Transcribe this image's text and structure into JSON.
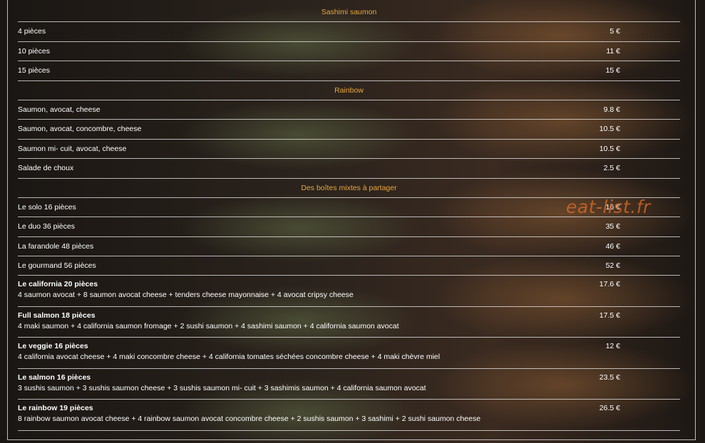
{
  "sections": [
    {
      "title": "Sashimi saumon",
      "items": [
        {
          "name": "4 pièces",
          "price": "5 €"
        },
        {
          "name": "10 pièces",
          "price": "11 €"
        },
        {
          "name": "15 pièces",
          "price": "15 €"
        }
      ]
    },
    {
      "title": "Rainbow",
      "items": [
        {
          "name": "Saumon, avocat, cheese",
          "price": "9.8 €"
        },
        {
          "name": "Saumon, avocat, concombre, cheese",
          "price": "10.5 €"
        },
        {
          "name": "Saumon mi- cuit, avocat, cheese",
          "price": "10.5 €"
        },
        {
          "name": "Salade de choux",
          "price": "2.5 €"
        }
      ]
    },
    {
      "title": "Des boîtes mixtes à partager",
      "items": [
        {
          "name": "Le solo 16 pièces",
          "price": "16 €"
        },
        {
          "name": "Le duo 36 pièces",
          "price": "35 €"
        },
        {
          "name": "La farandole 48 pièces",
          "price": "46 €"
        },
        {
          "name": "Le gourmand 56 pièces",
          "price": "52 €"
        }
      ],
      "combos": [
        {
          "name": "Le california 20 pièces",
          "price": "17.6 €",
          "description": "4 saumon avocat + 8 saumon avocat cheese + tenders cheese mayonnaise + 4 avocat cripsy cheese"
        },
        {
          "name": "Full salmon 18 pièces",
          "price": "17.5 €",
          "description": "4 maki saumon + 4 california saumon fromage + 2 sushi saumon + 4 sashimi saumon + 4 california saumon avocat"
        },
        {
          "name": "Le veggie 16 pièces",
          "price": "12 €",
          "description": "4 california avocat cheese + 4 maki concombre cheese + 4 california tomates séchées concombre cheese + 4 maki chèvre miel"
        },
        {
          "name": "Le salmon 16 pièces",
          "price": "23.5 €",
          "description": "3 sushis saumon + 3 sushis saumon cheese + 3 sushis saumon mi- cuit + 3 sashimis saumon + 4 california saumon avocat"
        },
        {
          "name": "Le rainbow 19 pièces",
          "price": "26.5 €",
          "description": "8 rainbow saumon avocat cheese + 4 rainbow saumon avocat concombre cheese + 2 sushis saumon + 3 sashimi + 2 sushi saumon cheese"
        }
      ]
    }
  ],
  "watermark": "eat-list.fr",
  "colors": {
    "section_title": "#e8a83a",
    "text": "#ffffff",
    "watermark": "#dc6e28"
  }
}
